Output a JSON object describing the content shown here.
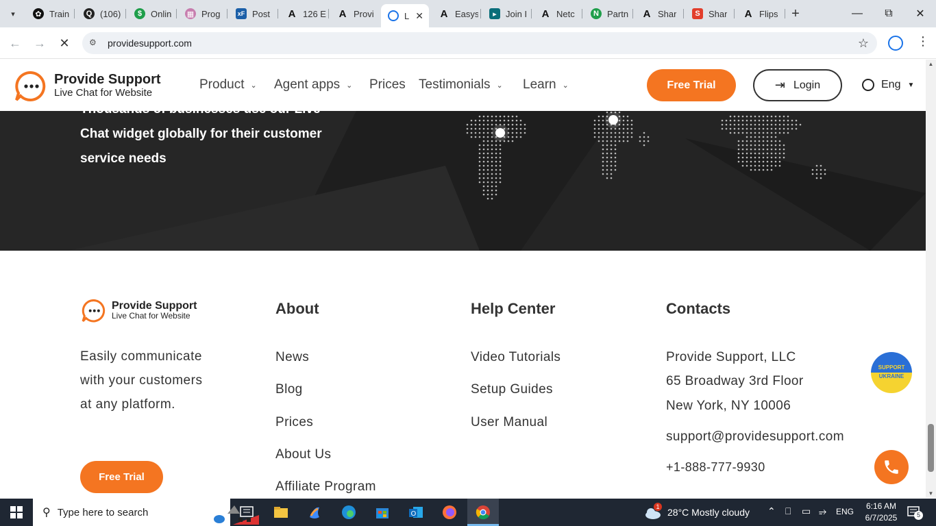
{
  "browser": {
    "tabs": [
      {
        "title": "Train",
        "favicon": "openai-icon",
        "color": "#111111"
      },
      {
        "title": "(106)",
        "favicon": "quora-icon",
        "color": "#222222"
      },
      {
        "title": "Onlin",
        "favicon": "dollar-icon",
        "color": "#1e9e4a"
      },
      {
        "title": "Prog",
        "favicon": "grid-icon",
        "color": "#c77dae"
      },
      {
        "title": "Post",
        "favicon": "xf-icon",
        "color": "#1b5fa8"
      },
      {
        "title": "126 E",
        "favicon": "a-icon",
        "color": "#111111"
      },
      {
        "title": "Provi",
        "favicon": "a-icon",
        "color": "#111111"
      },
      {
        "title": "L",
        "favicon": "providesupport-icon",
        "color": "#1a73e8",
        "active": true
      },
      {
        "title": "Easys",
        "favicon": "a-icon",
        "color": "#111111"
      },
      {
        "title": "Join I",
        "favicon": "join-icon",
        "color": "#0a6e7a"
      },
      {
        "title": "Netc",
        "favicon": "a-icon",
        "color": "#111111"
      },
      {
        "title": "Partn",
        "favicon": "partner-icon",
        "color": "#1e9e4a"
      },
      {
        "title": "Shar",
        "favicon": "a-icon",
        "color": "#111111"
      },
      {
        "title": "Shar",
        "favicon": "shar-icon",
        "color": "#e23d2b"
      },
      {
        "title": "Flips",
        "favicon": "a-icon",
        "color": "#111111"
      }
    ],
    "url": "providesupport.com"
  },
  "site": {
    "logo": {
      "name": "Provide Support",
      "tagline": "Live Chat for Website"
    },
    "nav": [
      "Product",
      "Agent apps",
      "Prices",
      "Testimonials",
      "Learn"
    ],
    "free_trial_label": "Free Trial",
    "login_label": "Login",
    "language": "Eng",
    "hero_text_lines": [
      "Thousands of businesses use our Live",
      "Chat widget globally for their customer",
      "service needs"
    ],
    "footer": {
      "logo_name": "Provide Support",
      "logo_tagline": "Live Chat for Website",
      "description": "Easily communicate with your customers at any platform.",
      "free_trial_label": "Free Trial",
      "about": {
        "title": "About",
        "links": [
          "News",
          "Blog",
          "Prices",
          "About Us",
          "Affiliate Program"
        ]
      },
      "help": {
        "title": "Help Center",
        "links": [
          "Video Tutorials",
          "Setup Guides",
          "User Manual"
        ]
      },
      "contacts": {
        "title": "Contacts",
        "company": "Provide Support, LLC",
        "address1": "65 Broadway 3rd Floor",
        "address2": "New York, NY 10006",
        "email": "support@providesupport.com",
        "phone": "+1-888-777-9930"
      },
      "ukraine_badge": [
        "SUPPORT",
        "UKRAINE"
      ]
    }
  },
  "taskbar": {
    "search_placeholder": "Type here to search",
    "weather": "28°C  Mostly cloudy",
    "weather_badge": "1",
    "language": "ENG",
    "time": "6:16 AM",
    "date": "6/7/2025",
    "notifications": "5"
  },
  "colors": {
    "accent": "#f47521",
    "dark_band": "#222222"
  }
}
